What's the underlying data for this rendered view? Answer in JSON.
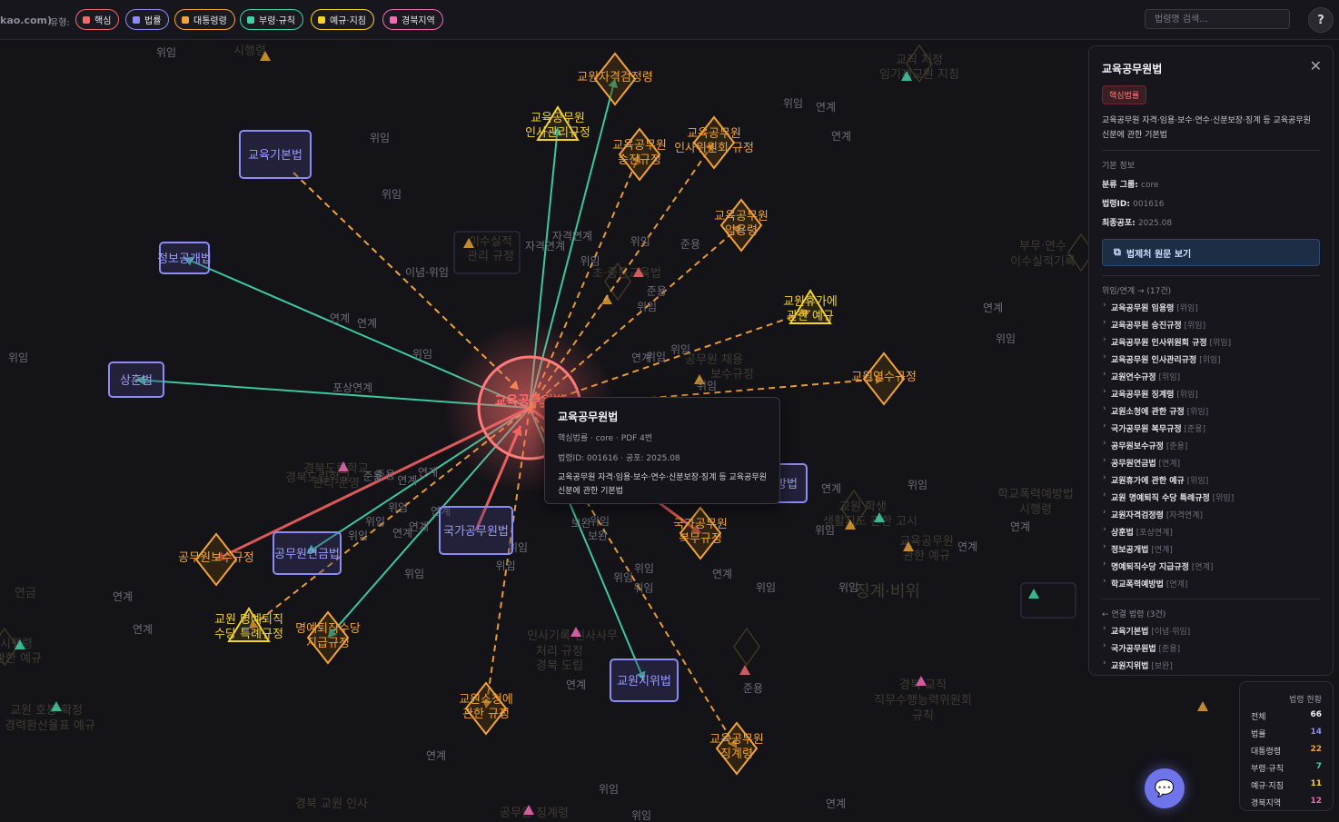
{
  "header": {
    "site_tag": "kao.com)",
    "filter_label": "유형:",
    "filters": [
      {
        "label": "핵심",
        "color": "#f06a6a"
      },
      {
        "label": "법률",
        "color": "#8b8cf5"
      },
      {
        "label": "대통령령",
        "color": "#f2a33a"
      },
      {
        "label": "부령·규칙",
        "color": "#3fd1a8"
      },
      {
        "label": "예규·지침",
        "color": "#f5d32a"
      },
      {
        "label": "경북지역",
        "color": "#f06ab6"
      }
    ],
    "search_placeholder": "법령명 검색...",
    "help_label": "?"
  },
  "graph": {
    "center": {
      "label": "교육공무원법",
      "color": "#f06a6a"
    },
    "laws": [
      {
        "id": "gibon",
        "label": "교육기본법"
      },
      {
        "id": "jungbo",
        "label": "정보공개법"
      },
      {
        "id": "sanghun",
        "label": "상훈법"
      },
      {
        "id": "yeongeum",
        "label": "공무원연금법"
      },
      {
        "id": "gukga",
        "label": "국가공무원법"
      },
      {
        "id": "gyowonji",
        "label": "교원지위법"
      },
      {
        "id": "yebang",
        "label": "예방법"
      }
    ],
    "decrees": [
      {
        "id": "jagyeok",
        "label": [
          "교원자격검정령"
        ]
      },
      {
        "id": "insagwalli",
        "label": [
          "교육공무원",
          "인사관리규정"
        ],
        "tri": true
      },
      {
        "id": "seungjin",
        "label": [
          "교육공무원",
          "승진규정"
        ]
      },
      {
        "id": "insawiwon",
        "label": [
          "교육공무원",
          "인사위원회 규정"
        ]
      },
      {
        "id": "imyong",
        "label": [
          "교육공무원",
          "임용령"
        ]
      },
      {
        "id": "hyuga",
        "label": [
          "교원휴가에",
          "관한 예규"
        ],
        "tri": true
      },
      {
        "id": "yeonsu",
        "label": [
          "교원연수규정"
        ]
      },
      {
        "id": "bosu",
        "label": [
          "공무원보수규정"
        ]
      },
      {
        "id": "myeongye_teukrye",
        "label": [
          "교원 명예퇴직",
          "수당 특례규정"
        ],
        "tri": true
      },
      {
        "id": "myeongye_jigeup",
        "label": [
          "명예퇴직수당",
          "지급규정"
        ]
      },
      {
        "id": "socheong",
        "label": [
          "교원소청에",
          "관한 규정"
        ]
      },
      {
        "id": "bokmu",
        "label": [
          "국가공무원",
          "복무규정"
        ]
      },
      {
        "id": "jinggye",
        "label": [
          "교육공무원",
          "징계령"
        ]
      }
    ],
    "edge_labels": [
      "위임",
      "연계",
      "자격연계",
      "이념·위임",
      "포상연계",
      "준용",
      "보완"
    ],
    "faded": [
      "시행령",
      "교직 지정",
      "임기제교원 지침",
      "부무·연수",
      "이수실적기록",
      "경북도립학교",
      "관리·운영",
      "공무원 채용",
      "보수규정",
      "학교폭력예방법",
      "시행령",
      "교원 학생",
      "생활지도 관한 고시",
      "교육공무원",
      "관한 예규",
      "징계·비위",
      "경북 교직",
      "직무수행능력위원회",
      "규칙",
      "교원 호봉 확정",
      "경력환산율표 예규",
      "연금",
      "시행령",
      "관한 예규",
      "경북 교원 인사",
      "공무원 징계령",
      "인사기록·인사사무",
      "처리 규정",
      "경북 도립",
      "이수실적",
      "관리 규정",
      "초·중등교육법",
      "경북도립학교"
    ]
  },
  "tooltip": {
    "title": "교육공무원법",
    "meta": "핵심법률 · core · PDF 4번",
    "meta2": "법령ID: 001616 · 공포: 2025.08",
    "desc": "교육공무원 자격·임용·보수·연수·신분보장·징계 등 교육공무원 신분에 관한 기본법"
  },
  "panel": {
    "title": "교육공무원법",
    "close_icon": "close-icon",
    "badge": "핵심법률",
    "desc": "교육공무원 자격·임용·보수·연수·신분보장·징계 등 교육공무원 신분에 관한 기본법",
    "basic_label": "기본 정보",
    "group_key": "분류 그룹:",
    "group_val": "core",
    "id_key": "법령ID:",
    "id_val": "001616",
    "date_key": "최종공포:",
    "date_val": "2025.08",
    "link_button": "법제처 원문 보기",
    "delegation_title": "위임/연계 → (17건)",
    "delegations": [
      {
        "name": "교육공무원 임용령",
        "rel": "[위임]"
      },
      {
        "name": "교육공무원 승진규정",
        "rel": "[위임]"
      },
      {
        "name": "교육공무원 인사위원회 규정",
        "rel": "[위임]"
      },
      {
        "name": "교육공무원 인사관리규정",
        "rel": "[위임]"
      },
      {
        "name": "교원연수규정",
        "rel": "[위임]"
      },
      {
        "name": "교육공무원 징계령",
        "rel": "[위임]"
      },
      {
        "name": "교원소청에 관한 규정",
        "rel": "[위임]"
      },
      {
        "name": "국가공무원 복무규정",
        "rel": "[준용]"
      },
      {
        "name": "공무원보수규정",
        "rel": "[준용]"
      },
      {
        "name": "공무원연금법",
        "rel": "[연계]"
      },
      {
        "name": "교원휴가에 관한 예규",
        "rel": "[위임]"
      },
      {
        "name": "교원 명예퇴직 수당 특례규정",
        "rel": "[위임]"
      },
      {
        "name": "교원자격검정령",
        "rel": "[자격연계]"
      },
      {
        "name": "상훈법",
        "rel": "[포상연계]"
      },
      {
        "name": "정보공개법",
        "rel": "[연계]"
      },
      {
        "name": "명예퇴직수당 지급규정",
        "rel": "[연계]"
      },
      {
        "name": "학교폭력예방법",
        "rel": "[연계]"
      }
    ],
    "incoming_title": "← 연결 법령 (3건)",
    "incoming": [
      {
        "name": "교육기본법",
        "rel": "[이념·위임]"
      },
      {
        "name": "국가공무원법",
        "rel": "[준용]"
      },
      {
        "name": "교원지위법",
        "rel": "[보완]"
      }
    ]
  },
  "stats": {
    "title": "법령 현황",
    "rows": [
      {
        "label": "전체",
        "value": "66",
        "color": "#f0f0f4"
      },
      {
        "label": "법률",
        "value": "14",
        "color": "#8b8cf5"
      },
      {
        "label": "대통령령",
        "value": "22",
        "color": "#f2a33a"
      },
      {
        "label": "부령·규칙",
        "value": "7",
        "color": "#3fd1a8"
      },
      {
        "label": "예규·지침",
        "value": "11",
        "color": "#f5d32a"
      },
      {
        "label": "경북지역",
        "value": "12",
        "color": "#f06ab6"
      }
    ]
  },
  "chat_icon": "chat-bubble-icon"
}
